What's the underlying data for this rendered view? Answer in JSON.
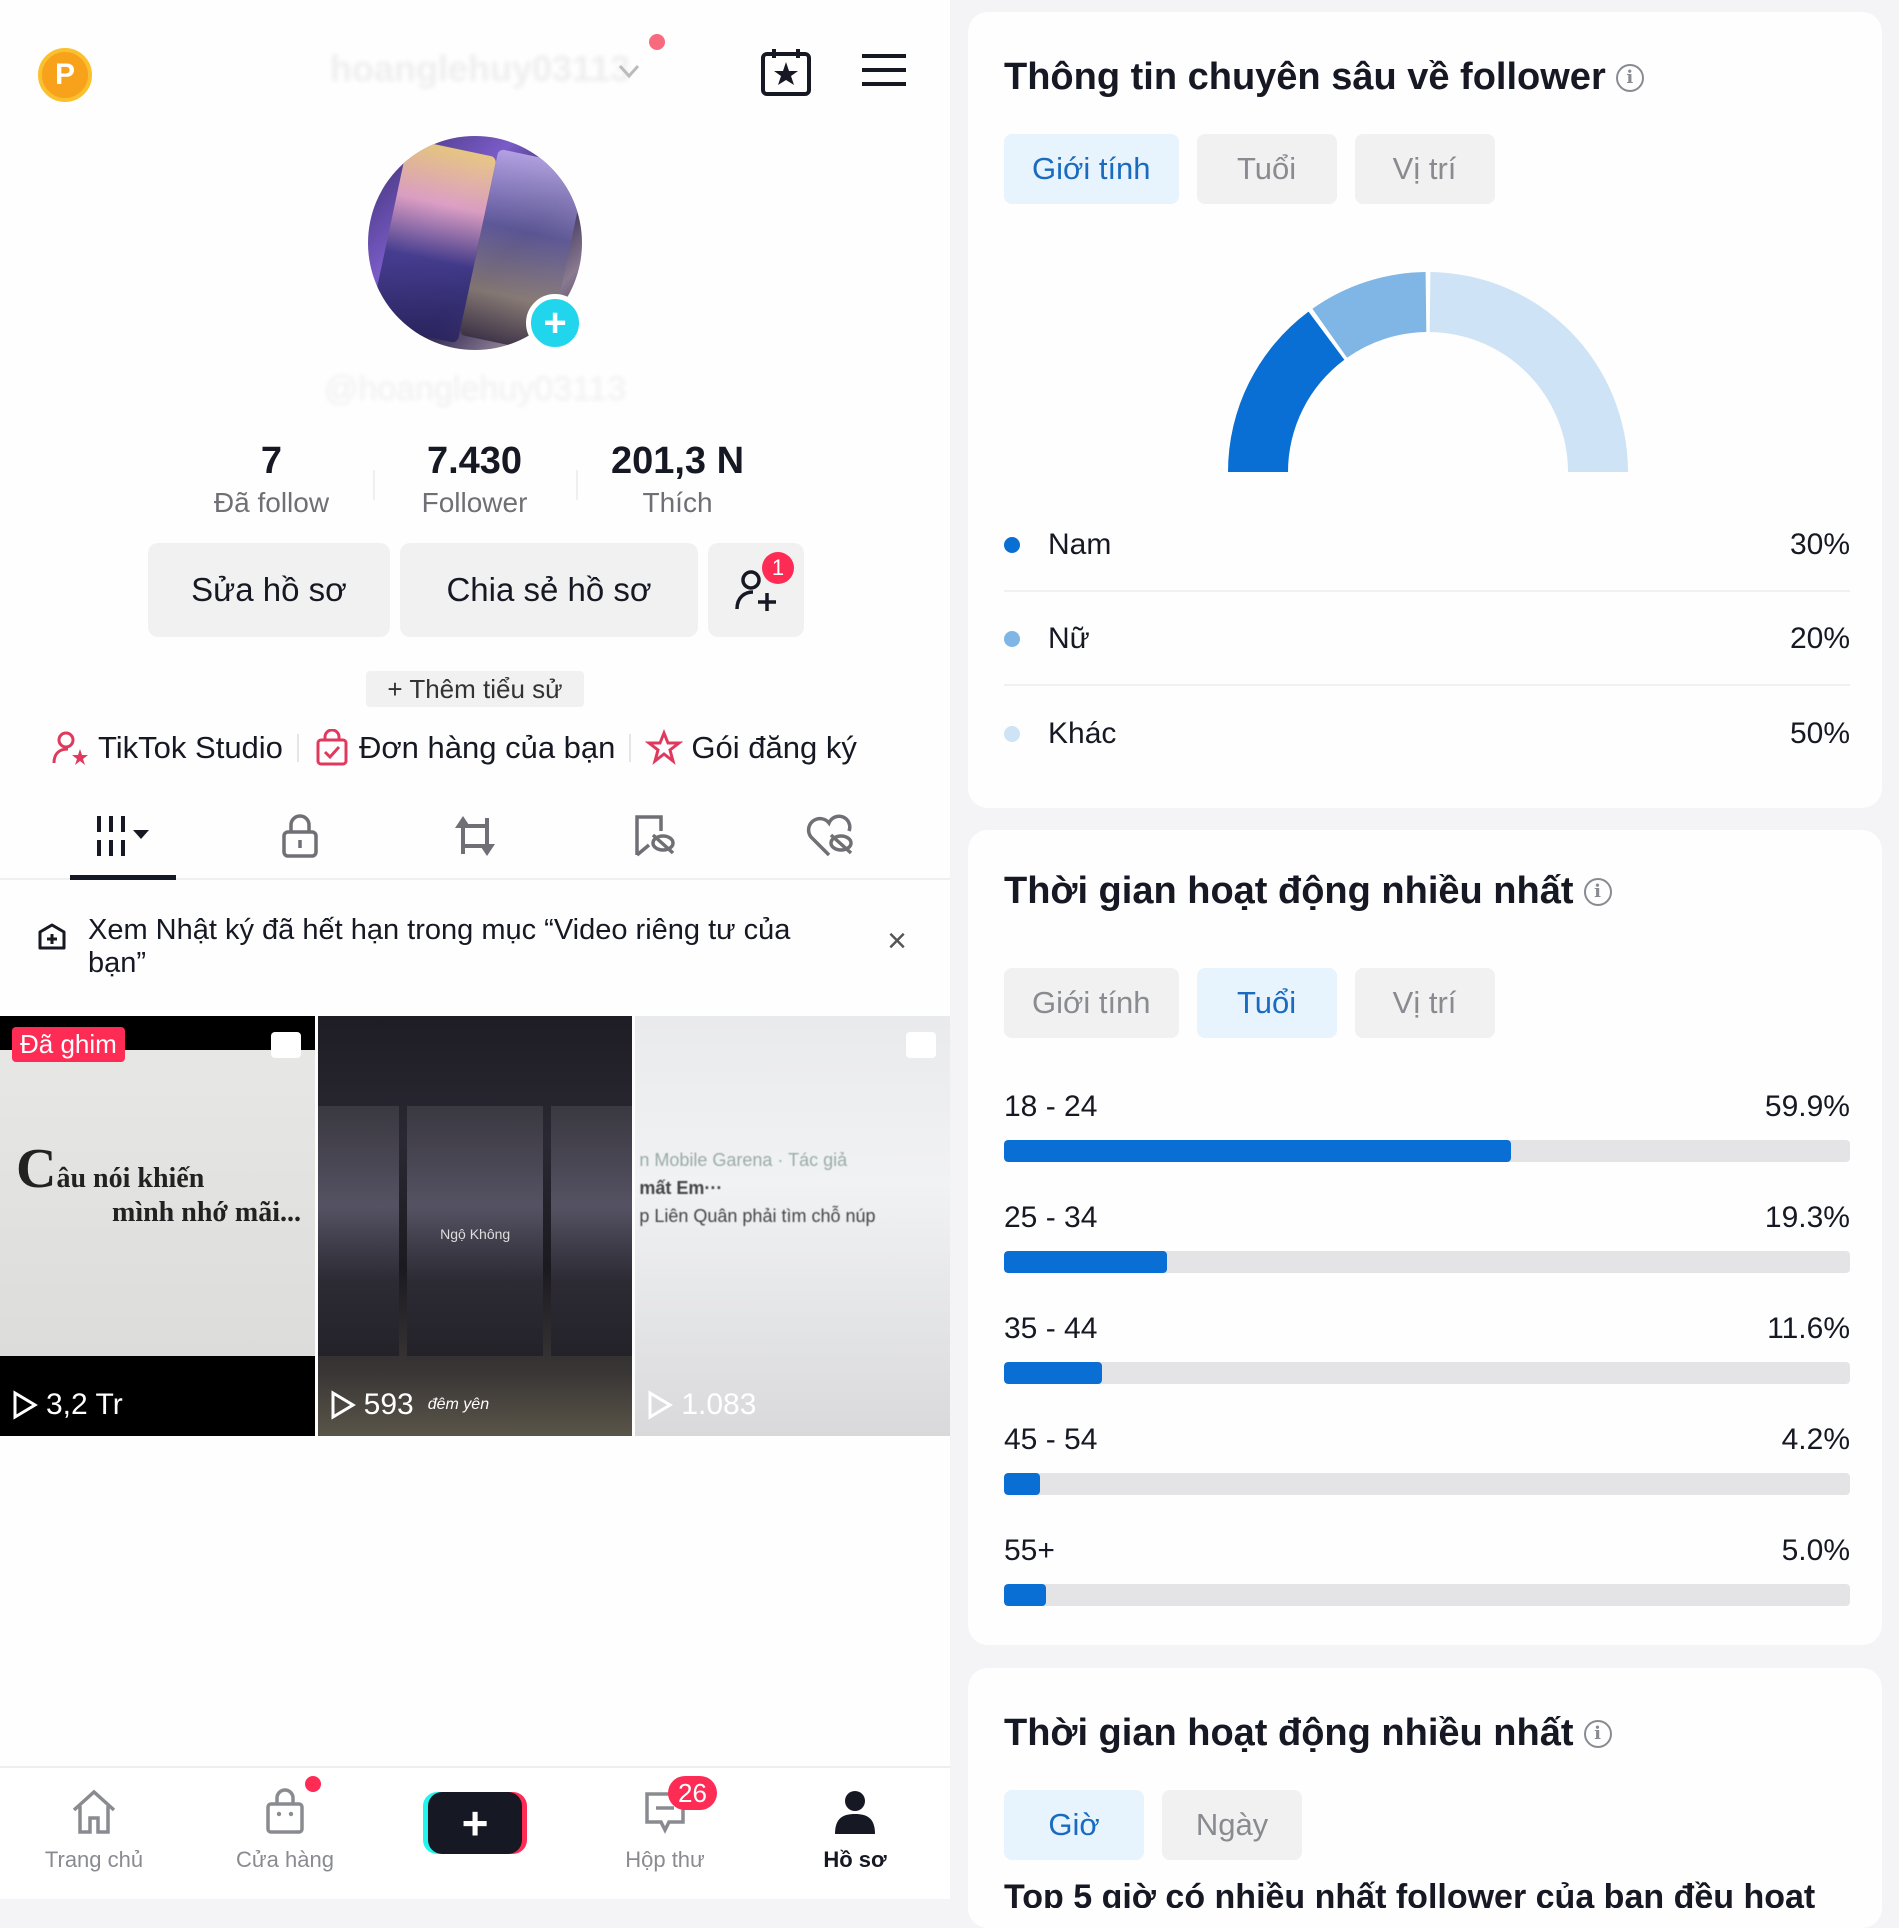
{
  "profile": {
    "username_top": "hoanglehuy03113",
    "handle": "@hoanglehuy03113",
    "stats": [
      {
        "value": "7",
        "label": "Đã follow"
      },
      {
        "value": "7.430",
        "label": "Follower"
      },
      {
        "value": "201,3 N",
        "label": "Thích"
      }
    ],
    "buttons": {
      "edit": "Sửa hồ sơ",
      "share": "Chia sẻ hồ sơ",
      "add_friend_badge": "1"
    },
    "bio_button": "+ Thêm tiểu sử",
    "links": [
      {
        "icon": "user-star-icon",
        "label": "TikTok Studio"
      },
      {
        "icon": "shopping-bag-check-icon",
        "label": "Đơn hàng của bạn"
      },
      {
        "icon": "star-ribbon-icon",
        "label": "Gói đăng ký"
      }
    ],
    "tabs": [
      {
        "icon": "grid-icon",
        "active": true
      },
      {
        "icon": "lock-icon",
        "active": false
      },
      {
        "icon": "repost-icon",
        "active": false
      },
      {
        "icon": "bookmark-hidden-icon",
        "active": false
      },
      {
        "icon": "heart-hidden-icon",
        "active": false
      }
    ],
    "notice": {
      "text": "Xem Nhật ký đã hết hạn trong mục “Video riêng tư của bạn”",
      "close": "×"
    },
    "videos": [
      {
        "pinned_label": "Đã ghim",
        "caption_big": "C",
        "caption_line1": "âu nói khiến",
        "caption_line2": "mình nhớ mãi...",
        "views": "3,2 Tr"
      },
      {
        "views": "593",
        "inner_text": "Ngộ Không",
        "inner_text2": "đêm yên"
      },
      {
        "views": "1.083",
        "inner_text": "n Mobile Garena · Tác giả",
        "inner_text2": "mất Em···",
        "inner_text3": "p Liên Quân phải tìm chỗ núp"
      }
    ]
  },
  "bottom_nav": {
    "items": [
      {
        "label": "Trang chủ",
        "icon": "home-icon",
        "active": false
      },
      {
        "label": "Cửa hàng",
        "icon": "shop-icon",
        "active": false
      },
      {
        "label": "",
        "icon": "create-plus-icon",
        "active": false
      },
      {
        "label": "Hộp thư",
        "icon": "inbox-icon",
        "active": false,
        "badge": "26"
      },
      {
        "label": "Hồ sơ",
        "icon": "profile-icon",
        "active": true
      }
    ]
  },
  "insights": {
    "follower_card": {
      "title": "Thông tin chuyên sâu về follower",
      "segments": [
        "Giới tính",
        "Tuổi",
        "Vị trí"
      ],
      "active_segment": "Giới tính"
    },
    "active_time_card": {
      "title": "Thời gian hoạt động nhiều nhất",
      "segments": [
        "Giới tính",
        "Tuổi",
        "Vị trí"
      ],
      "active_segment": "Tuổi"
    },
    "active_time_card2": {
      "title": "Thời gian hoạt động nhiều nhất",
      "segments": [
        "Giờ",
        "Ngày"
      ],
      "active_segment": "Giờ",
      "cut_text": "Top 5 giờ có nhiều nhất follower của bạn đều hoạt"
    }
  },
  "chart_data": [
    {
      "type": "pie",
      "title": "Thông tin chuyên sâu về follower",
      "subtype": "half-donut",
      "categories": [
        "Nam",
        "Nữ",
        "Khác"
      ],
      "values": [
        30,
        20,
        50
      ],
      "labels": [
        "30%",
        "20%",
        "50%"
      ],
      "colors": [
        "#0a6fd4",
        "#7fb6e6",
        "#cfe3f6"
      ]
    },
    {
      "type": "bar",
      "title": "Thời gian hoạt động nhiều nhất",
      "orientation": "horizontal",
      "categories": [
        "18 - 24",
        "25 - 34",
        "35 - 44",
        "45 - 54",
        "55+"
      ],
      "values": [
        59.9,
        19.3,
        11.6,
        4.2,
        5.0
      ],
      "labels": [
        "59.9%",
        "19.3%",
        "11.6%",
        "4.2%",
        "5.0%"
      ],
      "xlim": [
        0,
        100
      ],
      "color": "#0a6fd4"
    }
  ]
}
